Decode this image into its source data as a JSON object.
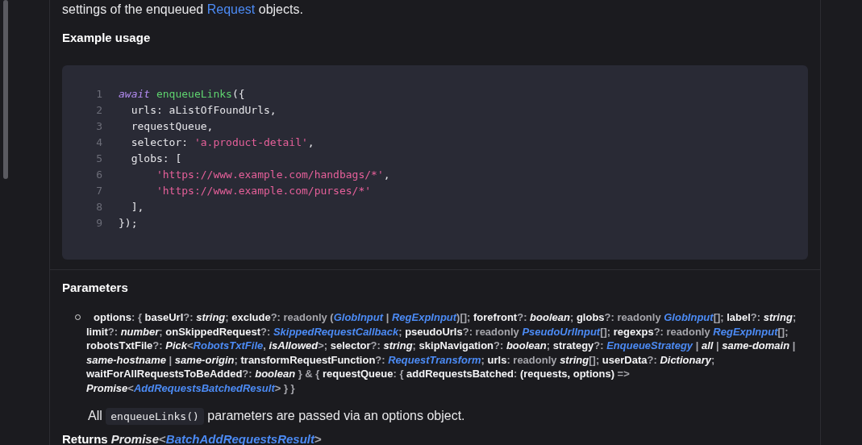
{
  "intro": [
    {
      "kind": "text",
      "text": "settings of the enqueued "
    },
    {
      "kind": "link",
      "text": "Request"
    },
    {
      "kind": "text",
      "text": " objects."
    }
  ],
  "example_heading": "Example usage",
  "code": [
    {
      "number": "1",
      "tokens": [
        {
          "kind": "keyword",
          "text": "await "
        },
        {
          "kind": "function",
          "text": "enqueueLinks"
        },
        {
          "kind": "plain",
          "text": "({"
        }
      ]
    },
    {
      "number": "2",
      "tokens": [
        {
          "kind": "plain",
          "text": "  urls: aListOfFoundUrls,"
        }
      ]
    },
    {
      "number": "3",
      "tokens": [
        {
          "kind": "plain",
          "text": "  requestQueue,"
        }
      ]
    },
    {
      "number": "4",
      "tokens": [
        {
          "kind": "plain",
          "text": "  selector: "
        },
        {
          "kind": "string",
          "text": "'a.product-detail'"
        },
        {
          "kind": "plain",
          "text": ","
        }
      ]
    },
    {
      "number": "5",
      "tokens": [
        {
          "kind": "plain",
          "text": "  globs: ["
        }
      ]
    },
    {
      "number": "6",
      "tokens": [
        {
          "kind": "string",
          "text": "      'https://www.example.com/handbags/*'"
        },
        {
          "kind": "plain",
          "text": ","
        }
      ]
    },
    {
      "number": "7",
      "tokens": [
        {
          "kind": "string",
          "text": "      'https://www.example.com/purses/*'"
        }
      ]
    },
    {
      "number": "8",
      "tokens": [
        {
          "kind": "plain",
          "text": "  ],"
        }
      ]
    },
    {
      "number": "9",
      "tokens": [
        {
          "kind": "plain",
          "text": "});"
        }
      ]
    }
  ],
  "parameters_heading": "Parameters",
  "signature": [
    {
      "kind": "name",
      "text": "options"
    },
    {
      "kind": "punct",
      "text": ": { "
    },
    {
      "kind": "name",
      "text": "baseUrl"
    },
    {
      "kind": "punct",
      "text": "?: "
    },
    {
      "kind": "type",
      "text": "string"
    },
    {
      "kind": "punct",
      "text": "; "
    },
    {
      "kind": "name",
      "text": "exclude"
    },
    {
      "kind": "punct",
      "text": "?: readonly ("
    },
    {
      "kind": "link",
      "text": "GlobInput"
    },
    {
      "kind": "punct",
      "text": " | "
    },
    {
      "kind": "link",
      "text": "RegExpInput"
    },
    {
      "kind": "punct",
      "text": ")[]; "
    },
    {
      "kind": "name",
      "text": "forefront"
    },
    {
      "kind": "punct",
      "text": "?: "
    },
    {
      "kind": "type",
      "text": "boolean"
    },
    {
      "kind": "punct",
      "text": "; "
    },
    {
      "kind": "name",
      "text": "globs"
    },
    {
      "kind": "punct",
      "text": "?: readonly "
    },
    {
      "kind": "link",
      "text": "GlobInput"
    },
    {
      "kind": "punct",
      "text": "[]; "
    },
    {
      "kind": "name",
      "text": "label"
    },
    {
      "kind": "punct",
      "text": "?: "
    },
    {
      "kind": "type",
      "text": "string"
    },
    {
      "kind": "punct",
      "text": "; "
    },
    {
      "kind": "name",
      "text": "limit"
    },
    {
      "kind": "punct",
      "text": "?: "
    },
    {
      "kind": "type",
      "text": "number"
    },
    {
      "kind": "punct",
      "text": "; "
    },
    {
      "kind": "name",
      "text": "onSkippedRequest"
    },
    {
      "kind": "punct",
      "text": "?: "
    },
    {
      "kind": "link",
      "text": "SkippedRequestCallback"
    },
    {
      "kind": "punct",
      "text": "; "
    },
    {
      "kind": "name",
      "text": "pseudoUrls"
    },
    {
      "kind": "punct",
      "text": "?: readonly "
    },
    {
      "kind": "link",
      "text": "PseudoUrlInput"
    },
    {
      "kind": "punct",
      "text": "[]; "
    },
    {
      "kind": "name",
      "text": "regexps"
    },
    {
      "kind": "punct",
      "text": "?: readonly "
    },
    {
      "kind": "link",
      "text": "RegExpInput"
    },
    {
      "kind": "punct",
      "text": "[]; "
    },
    {
      "kind": "name",
      "text": "robotsTxtFile"
    },
    {
      "kind": "punct",
      "text": "?: "
    },
    {
      "kind": "type",
      "text": "Pick"
    },
    {
      "kind": "punct",
      "text": "<"
    },
    {
      "kind": "link",
      "text": "RobotsTxtFile"
    },
    {
      "kind": "punct",
      "text": ", "
    },
    {
      "kind": "type",
      "text": "isAllowed"
    },
    {
      "kind": "punct",
      "text": ">; "
    },
    {
      "kind": "name",
      "text": "selector"
    },
    {
      "kind": "punct",
      "text": "?: "
    },
    {
      "kind": "type",
      "text": "string"
    },
    {
      "kind": "punct",
      "text": "; "
    },
    {
      "kind": "name",
      "text": "skipNavigation"
    },
    {
      "kind": "punct",
      "text": "?: "
    },
    {
      "kind": "type",
      "text": "boolean"
    },
    {
      "kind": "punct",
      "text": "; "
    },
    {
      "kind": "name",
      "text": "strategy"
    },
    {
      "kind": "punct",
      "text": "?: "
    },
    {
      "kind": "link",
      "text": "EnqueueStrategy"
    },
    {
      "kind": "punct",
      "text": " | "
    },
    {
      "kind": "type",
      "text": "all"
    },
    {
      "kind": "punct",
      "text": " | "
    },
    {
      "kind": "type",
      "text": "same-domain"
    },
    {
      "kind": "punct",
      "text": " | "
    },
    {
      "kind": "type",
      "text": "same-hostname"
    },
    {
      "kind": "punct",
      "text": " | "
    },
    {
      "kind": "type",
      "text": "same-origin"
    },
    {
      "kind": "punct",
      "text": "; "
    },
    {
      "kind": "name",
      "text": "transformRequestFunction"
    },
    {
      "kind": "punct",
      "text": "?: "
    },
    {
      "kind": "link",
      "text": "RequestTransform"
    },
    {
      "kind": "punct",
      "text": "; "
    },
    {
      "kind": "name",
      "text": "urls"
    },
    {
      "kind": "punct",
      "text": ": readonly "
    },
    {
      "kind": "type",
      "text": "string"
    },
    {
      "kind": "punct",
      "text": "[]; "
    },
    {
      "kind": "name",
      "text": "userData"
    },
    {
      "kind": "punct",
      "text": "?: "
    },
    {
      "kind": "type",
      "text": "Dictionary"
    },
    {
      "kind": "punct",
      "text": "; "
    },
    {
      "kind": "name",
      "text": "waitForAllRequestsToBeAdded"
    },
    {
      "kind": "punct",
      "text": "?: "
    },
    {
      "kind": "type",
      "text": "boolean"
    },
    {
      "kind": "punct",
      "text": " } & { "
    },
    {
      "kind": "name",
      "text": "requestQueue"
    },
    {
      "kind": "punct",
      "text": ": { "
    },
    {
      "kind": "name",
      "text": "addRequestsBatched"
    },
    {
      "kind": "punct",
      "text": ": "
    },
    {
      "kind": "name",
      "text": "(requests, options)"
    },
    {
      "kind": "punct",
      "text": " => "
    },
    {
      "kind": "type",
      "text": "Promise"
    },
    {
      "kind": "punct",
      "text": "<"
    },
    {
      "kind": "link",
      "text": "AddRequestsBatchedResult"
    },
    {
      "kind": "punct",
      "text": "> } }"
    }
  ],
  "description": [
    {
      "kind": "text",
      "text": "All "
    },
    {
      "kind": "code",
      "text": "enqueueLinks()"
    },
    {
      "kind": "text",
      "text": " parameters are passed via an options object."
    }
  ],
  "returns": [
    {
      "kind": "name",
      "text": "Returns "
    },
    {
      "kind": "type",
      "text": "Promise"
    },
    {
      "kind": "punct",
      "text": "<"
    },
    {
      "kind": "link",
      "text": "BatchAddRequestsResult"
    },
    {
      "kind": "punct",
      "text": ">"
    }
  ]
}
